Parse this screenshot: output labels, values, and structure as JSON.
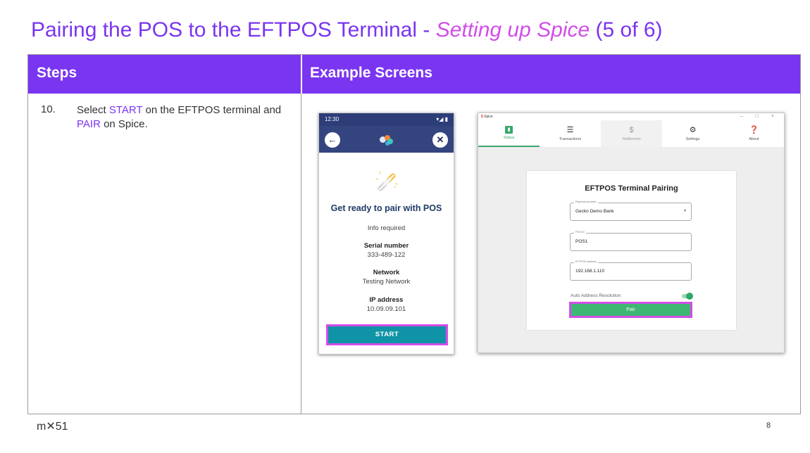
{
  "title": {
    "main": "Pairing the POS to the EFTPOS Terminal - ",
    "sub": "Setting up Spice",
    "suffix": " (5 of 6)"
  },
  "table": {
    "col_steps": "Steps",
    "col_screens": "Example Screens"
  },
  "step": {
    "number": "10.",
    "text_1": "Select ",
    "highlight_1": "START",
    "text_2": " on the EFTPOS terminal and ",
    "highlight_2": "PAIR",
    "text_3": " on Spice."
  },
  "phone": {
    "time": "12:30",
    "signal": "▾◢ ▮",
    "back_icon": "arrow-left-icon",
    "close_icon": "close-icon",
    "heading": "Get ready to pair with POS",
    "info": "Info required",
    "serial_label": "Serial number",
    "serial_value": "333-489-122",
    "network_label": "Network",
    "network_value": "Testing Network",
    "ip_label": "IP address",
    "ip_value": "10.09.09.101",
    "start_label": "START"
  },
  "desktop": {
    "app_name": "Spice",
    "window_controls": "– □ ×",
    "nav": [
      {
        "label": "Status",
        "icon": "bar-chart-icon"
      },
      {
        "label": "Transactions",
        "icon": "list-icon"
      },
      {
        "label": "Settlement",
        "icon": "hand-money-icon"
      },
      {
        "label": "Settings",
        "icon": "gear-icon"
      },
      {
        "label": "About",
        "icon": "question-icon"
      }
    ],
    "card_title": "EFTPOS Terminal Pairing",
    "provider_label": "Payment provider",
    "provider_value": "Gecko Demo Bank",
    "posid_label": "POS ID",
    "posid_value": "POS1",
    "address_label": "EFTPOS address",
    "address_value": "192.168.1.110",
    "auto_label": "Auto Address Resolution",
    "auto_enabled": true,
    "pair_label": "Pair"
  },
  "colors": {
    "brand_purple": "#7a35f0",
    "highlight_pink": "#d24de8",
    "spice_green": "#3fb774",
    "terminal_teal": "#0f93a6"
  },
  "footer": {
    "logo": "m✕51",
    "page": "8"
  }
}
